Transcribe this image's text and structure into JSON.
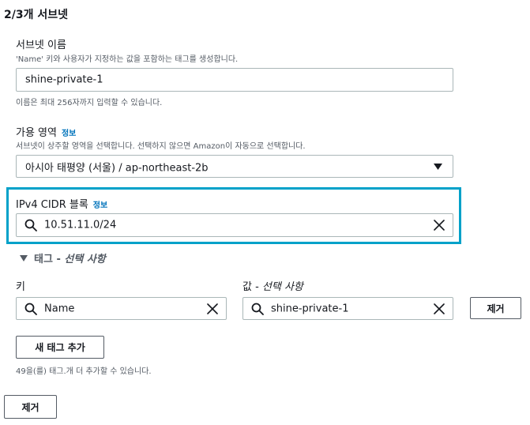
{
  "section": {
    "title": "2/3개 서브넷"
  },
  "subnet_name": {
    "label": "서브넷 이름",
    "description": "'Name' 키와 사용자가 지정하는 값을 포함하는 태그를 생성합니다.",
    "value": "shine-private-1",
    "hint": "이름은 최대 256자까지 입력할 수 있습니다."
  },
  "availability_zone": {
    "label": "가용 영역",
    "info": "정보",
    "description": "서브넷이 상주할 영역을 선택합니다. 선택하지 않으면 Amazon이 자동으로 선택합니다.",
    "selected": "아시아 태평양 (서울) / ap-northeast-2b"
  },
  "cidr": {
    "label": "IPv4 CIDR 블록",
    "info": "정보",
    "value": "10.51.11.0/24"
  },
  "tags": {
    "toggle_label": "태그 - ",
    "toggle_label_italic": "선택 사항",
    "key_label": "키",
    "value_label": "값 - ",
    "value_label_italic": "선택 사항",
    "key_value": "Name",
    "value_value": "shine-private-1",
    "remove_tag_label": "제거",
    "add_tag_label": "새 태그 추가",
    "remaining_text": "49을(를) 태그.개 더 추가할 수 있습니다."
  },
  "remove_subnet_label": "제거",
  "colors": {
    "focus": "#00a1c9",
    "link": "#0073bb",
    "border": "#aab7b8",
    "text": "#16191f",
    "muted": "#545b64"
  },
  "icons": {
    "search": "search-icon",
    "clear": "close-icon",
    "dropdown": "caret-down-icon",
    "expand": "caret-down-icon"
  }
}
